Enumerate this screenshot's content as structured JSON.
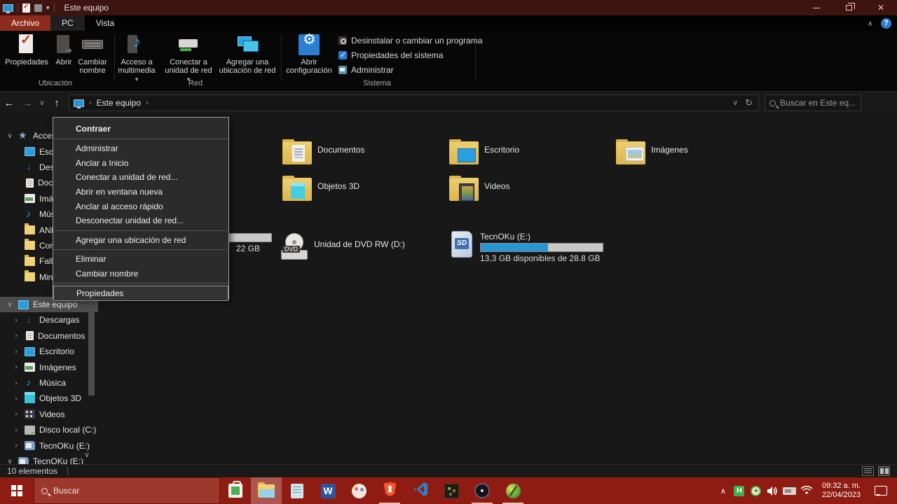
{
  "colors": {
    "titlebar": "#3E1410",
    "taskbar": "#8E1C12",
    "tab_active": "#8D2C1D",
    "menu_bg": "#2B2B2B",
    "selection": "#4C4C4C",
    "folder_yellow": "#E8C14F",
    "capacity_fill": "#2797D4"
  },
  "titlebar": {
    "title": "Este equipo"
  },
  "tabs": {
    "archivo": "Archivo",
    "pc": "PC",
    "vista": "Vista"
  },
  "ribbon": {
    "ubicacion": {
      "label": "Ubicación",
      "propiedades": "Propiedades",
      "abrir": "Abrir",
      "cambiar_nombre": "Cambiar nombre"
    },
    "red": {
      "label": "Red",
      "acceso": "Acceso a multimedia",
      "conectar": "Conectar a unidad de red",
      "agregar": "Agregar una ubicación de red"
    },
    "sistema": {
      "label": "Sistema",
      "abrir_configuracion": "Abrir configuración",
      "desinstalar": "Desinstalar o cambiar un programa",
      "propiedades_sistema": "Propiedades del sistema",
      "administrar": "Administrar"
    }
  },
  "navbar": {
    "location": "Este equipo",
    "crumb_sep": "›",
    "search_placeholder": "Buscar en Este eq..."
  },
  "context_menu": {
    "items": [
      "Contraer",
      "Administrar",
      "Anclar a Inicio",
      "Conectar a unidad de red...",
      "Abrir en ventana nueva",
      "Anclar al acceso rápido",
      "Desconectar unidad de red...",
      "Agregar una ubicación de red",
      "Eliminar",
      "Cambiar nombre",
      "Propiedades"
    ]
  },
  "sidebar": {
    "quick_access": {
      "label": "Acceso rápido",
      "items": [
        "Escritorio",
        "Descargas",
        "Documentos",
        "Imágenes",
        "Música",
        "ANIM",
        "Com",
        "Fallo",
        "Minia"
      ]
    },
    "this_pc": {
      "label": "Este equipo",
      "items": [
        "Descargas",
        "Documentos",
        "Escritorio",
        "Imágenes",
        "Música",
        "Objetos 3D",
        "Videos",
        "Disco local (C:)",
        "TecnOKu (E:)"
      ]
    },
    "bottom_item": "TecnOKu (E:)"
  },
  "main": {
    "folders": [
      "Documentos",
      "Escritorio",
      "Imágenes",
      "Objetos 3D",
      "Videos"
    ],
    "drives": [
      {
        "name": "",
        "detail": "22 GB",
        "fill_style": "width:65%"
      },
      {
        "name": "Unidad de DVD RW (D:)",
        "detail": "",
        "fill_style": ""
      },
      {
        "name": "TecnOKu (E:)",
        "detail": "13,3 GB disponibles de 28.8 GB",
        "fill_style": "width:55%"
      }
    ],
    "dvd_tag": "DVD",
    "sd_tag": "SD"
  },
  "statusbar": {
    "count": "10 elementos"
  },
  "taskbar": {
    "search_placeholder": "Buscar",
    "clock_time": "09:32 a. m.",
    "clock_date": "22/04/2023"
  }
}
